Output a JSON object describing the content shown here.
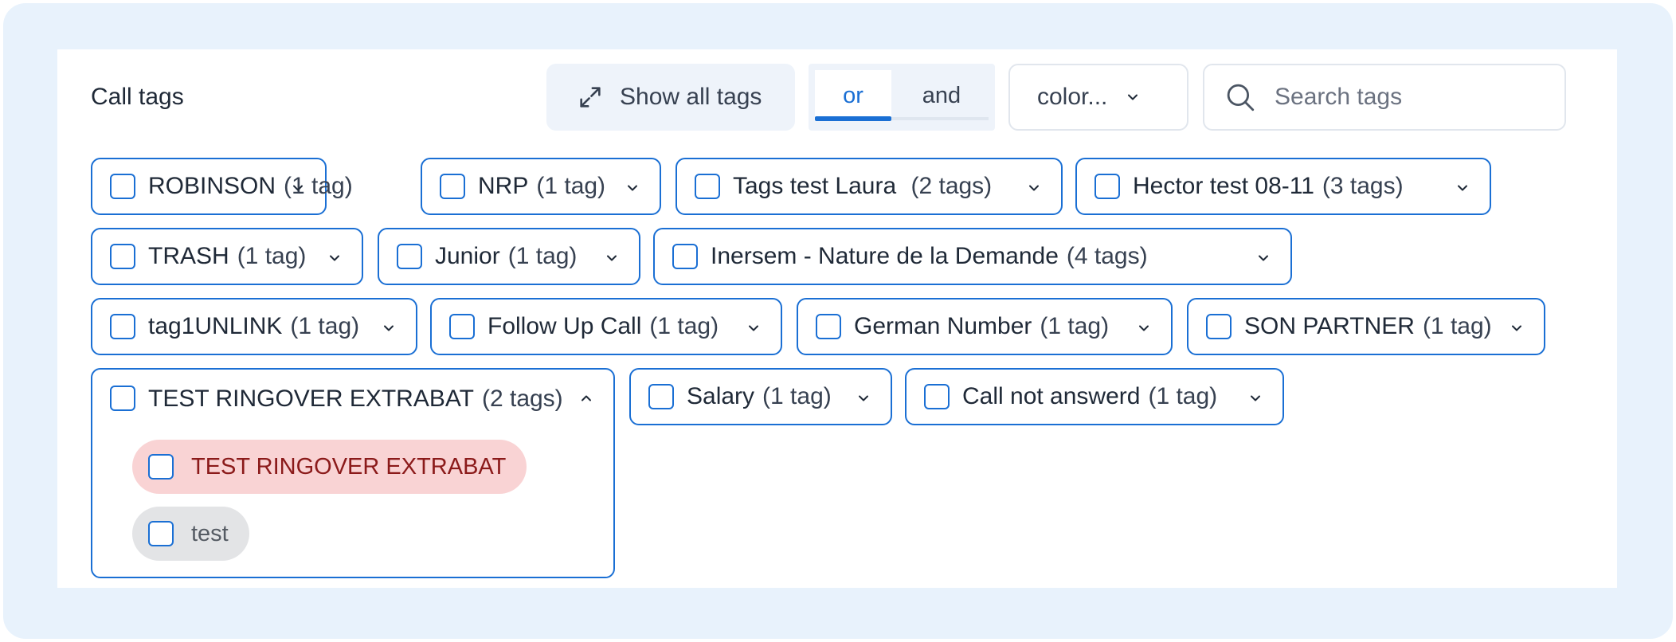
{
  "header": {
    "title": "Call tags",
    "show_all_label": "Show all tags",
    "logic_or": "or",
    "logic_and": "and",
    "color_select": "color...",
    "search_placeholder": "Search tags"
  },
  "groups": [
    {
      "name": "ROBINSON",
      "count": "(1 tag)"
    },
    {
      "name": "NRP",
      "count": "(1 tag)"
    },
    {
      "name": "Tags test Laura ",
      "count": "(2 tags)"
    },
    {
      "name": "Hector test 08-11",
      "count": "(3 tags)"
    },
    {
      "name": "TRASH",
      "count": "(1 tag)"
    },
    {
      "name": "Junior",
      "count": "(1 tag)"
    },
    {
      "name": "Inersem - Nature de la Demande",
      "count": "(4 tags)"
    },
    {
      "name": "tag1UNLINK",
      "count": "(1 tag)"
    },
    {
      "name": "Follow Up Call",
      "count": "(1 tag)"
    },
    {
      "name": "German Number",
      "count": "(1 tag)"
    },
    {
      "name": "SON PARTNER",
      "count": "(1 tag)"
    },
    {
      "name": "TEST RINGOVER EXTRABAT",
      "count": "(2 tags)",
      "expanded": true,
      "tags": [
        {
          "label": "TEST RINGOVER EXTRABAT",
          "color": "#f9d3d4"
        },
        {
          "label": "test",
          "color": "#e3e4e6"
        }
      ]
    },
    {
      "name": "Salary",
      "count": "(1 tag)"
    },
    {
      "name": "Call not answerd",
      "count": "(1 tag)"
    }
  ],
  "colors": {
    "accent": "#1a6fd4",
    "frame_bg": "#e8f2fc"
  }
}
